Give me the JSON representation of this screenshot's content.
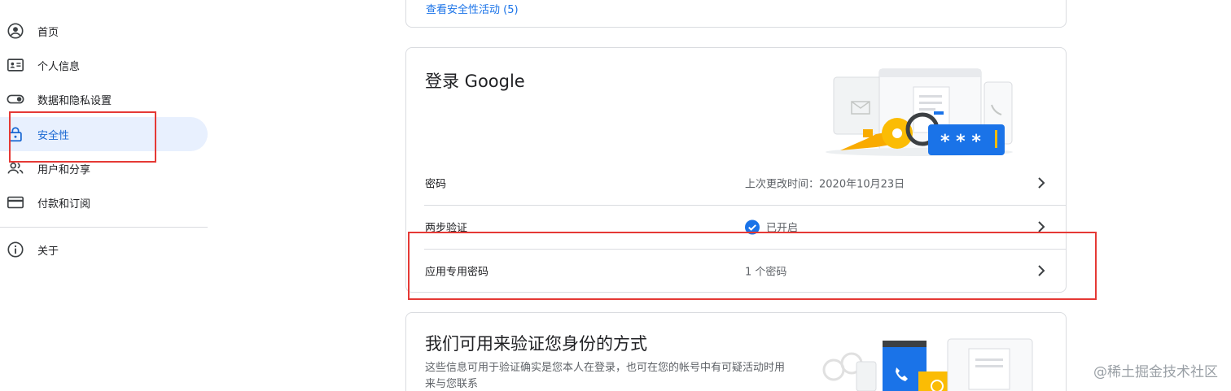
{
  "sidebar": {
    "items": [
      {
        "label": "首页",
        "icon": "account-circle-icon"
      },
      {
        "label": "个人信息",
        "icon": "id-card-icon"
      },
      {
        "label": "数据和隐私设置",
        "icon": "toggle-icon"
      },
      {
        "label": "安全性",
        "icon": "lock-icon",
        "active": true
      },
      {
        "label": "用户和分享",
        "icon": "people-icon"
      },
      {
        "label": "付款和订阅",
        "icon": "credit-card-icon"
      }
    ],
    "about": {
      "label": "关于",
      "icon": "info-icon"
    }
  },
  "security_activity": {
    "link": "查看安全性活动 (5)"
  },
  "signin_card": {
    "title": "登录 Google",
    "rows": [
      {
        "label": "密码",
        "value": "上次更改时间：2020年10月23日"
      },
      {
        "label": "两步验证",
        "value": "已开启",
        "status_icon": "check-circle-icon"
      },
      {
        "label": "应用专用密码",
        "value": "1 个密码"
      }
    ]
  },
  "verify_card": {
    "title": "我们可用来验证您身份的方式",
    "description": "这些信息可用于验证确实是您本人在登录，也可在您的帐号中有可疑活动时用来与您联系"
  },
  "colors": {
    "accent": "#1a73e8",
    "active_bg": "#e8f0fe",
    "highlight": "#e53935"
  },
  "watermark": "@稀土掘金技术社区"
}
